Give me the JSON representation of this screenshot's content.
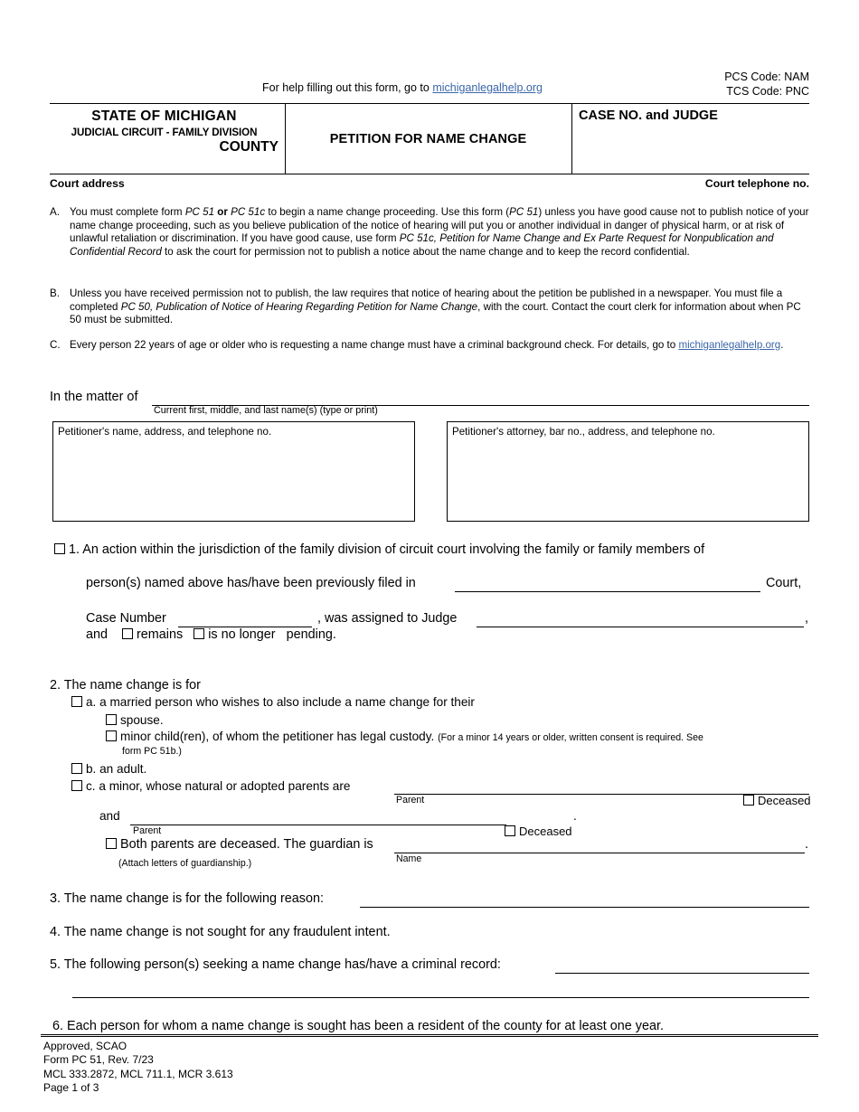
{
  "codes": {
    "pcs": "PCS Code: NAM",
    "tcs": "TCS Code: PNC"
  },
  "help": {
    "prefix": "For help filling out this form, go to ",
    "link": "michiganlegalhelp.org"
  },
  "header": {
    "state": "STATE OF MICHIGAN",
    "judicial": "JUDICIAL CIRCUIT - FAMILY DIVISION",
    "county": "COUNTY",
    "form_title": "PETITION FOR NAME CHANGE",
    "case_no_judge": "CASE NO. and JUDGE",
    "court_address": "Court address",
    "court_telephone": "Court telephone no."
  },
  "instructions": [
    {
      "letter": "A.",
      "segments": [
        {
          "text": "You must complete form ",
          "style": "normal"
        },
        {
          "text": "PC 51",
          "style": "italic"
        },
        {
          "text": " or ",
          "style": "bold"
        },
        {
          "text": "PC 51c",
          "style": "italic"
        },
        {
          "text": " to begin a name change proceeding. Use this form (",
          "style": "normal"
        },
        {
          "text": "PC 51",
          "style": "italic"
        },
        {
          "text": ") unless you have good cause not to publish notice of your name change proceeding, such as you believe publication of the notice of hearing will put you or another individual in danger of physical harm, or at risk of unlawful retaliation or discrimination. If you have good cause, use form ",
          "style": "normal"
        },
        {
          "text": "PC 51c, Petition for Name Change and Ex Parte Request for Nonpublication and Confidential Record",
          "style": "italic"
        },
        {
          "text": " to ask the court for permission not to publish a notice about the name change and to keep the record confidential.",
          "style": "normal"
        }
      ]
    },
    {
      "letter": "B.",
      "segments": [
        {
          "text": "Unless you have received permission not to publish, the law requires that notice of hearing about the petition be published in a newspaper. You must file a completed ",
          "style": "normal"
        },
        {
          "text": "PC 50, Publication of Notice of Hearing Regarding Petition for Name Change",
          "style": "italic"
        },
        {
          "text": ", with the court. Contact the court clerk for information about when PC 50 must be submitted.",
          "style": "normal"
        }
      ]
    },
    {
      "letter": "C.",
      "segments": [
        {
          "text": "Every person 22 years of age or older who is requesting a name change must have a criminal background check. For details, go to ",
          "style": "normal"
        },
        {
          "text": "michiganlegalhelp.org",
          "style": "link"
        },
        {
          "text": ".",
          "style": "normal"
        }
      ]
    }
  ],
  "matter": {
    "label": "In the matter of",
    "caption": "Current first, middle, and last name(s) (type or print)"
  },
  "parties": {
    "petitioner": "Petitioner's name, address, and telephone no.",
    "attorney": "Petitioner's attorney, bar no., address, and telephone no."
  },
  "item1": {
    "number": "1.",
    "line1": "An action within the jurisdiction of the family division of circuit court involving the family or family members of",
    "line2": "person(s) named above has/have been previously filed in",
    "court_word": "Court,",
    "case_number_label": "Case Number",
    "comma1": ",",
    "assigned": "was assigned to Judge",
    "comma2": ",",
    "and_label": "and",
    "remains": "remains",
    "is_no_longer": "is no longer",
    "pending": "pending."
  },
  "item2": {
    "number": "2.",
    "heading": "The name change is for",
    "a_letter": "a.",
    "a_text": "a married person who wishes to also include a name change for their",
    "a_spouse": "spouse.",
    "a_minor": "minor child(ren), of whom the petitioner has legal custody.",
    "a_minor_note": "(For a minor 14 years or older, written consent is required. See",
    "a_minor_note2": "form PC 51b.)",
    "b_letter": "b.",
    "b_text": "an adult.",
    "c_letter": "c.",
    "c_text": "a minor, whose natural or adopted parents are",
    "parent_caption": "Parent",
    "deceased": "Deceased",
    "and_label": "and",
    "period": ".",
    "both_deceased": "Both parents are deceased. The guardian is",
    "name_caption": "Name",
    "attach": "(Attach letters of guardianship.)",
    "trailing_period": "."
  },
  "item3": {
    "number": "3.",
    "text": "The name change is for the following reason:"
  },
  "item4": {
    "number": "4.",
    "text": "The name change is not sought for any fraudulent intent."
  },
  "item5": {
    "number": "5.",
    "text": "The following person(s) seeking a name change has/have a criminal record:"
  },
  "item6": {
    "number": "6.",
    "text": "Each person for whom a name change is sought has been a resident of the county for at least one year."
  },
  "footer": {
    "approved": "Approved, SCAO",
    "form": "Form PC 51, Rev. 7/23",
    "mcl": "MCL 333.2872, MCL 711.1, MCR 3.613",
    "page": "Page 1 of 3"
  },
  "colors": {
    "link": "#3a66a8",
    "rule": "#000000"
  }
}
